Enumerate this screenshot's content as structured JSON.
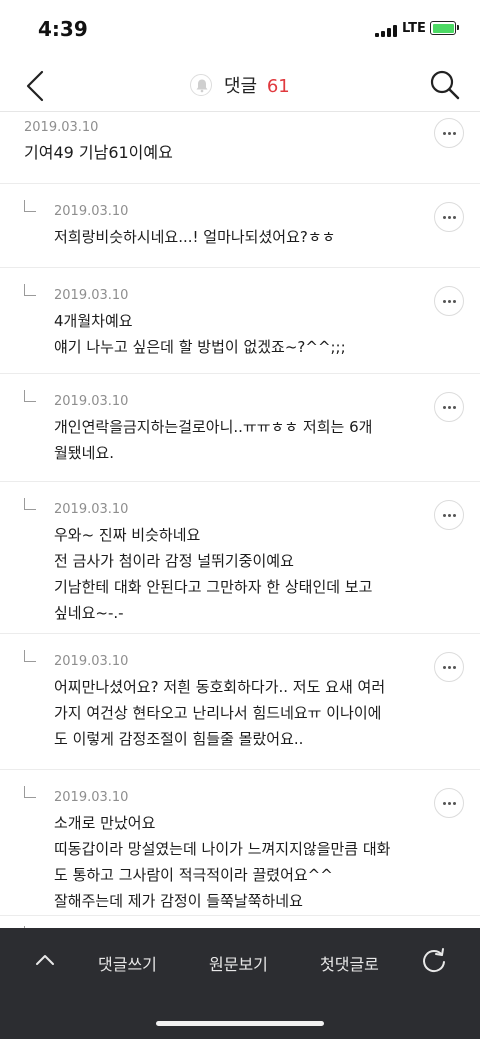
{
  "status": {
    "time": "4:39",
    "network": "LTE"
  },
  "nav": {
    "title": "댓글",
    "count": "61"
  },
  "comments": [
    {
      "date": "2019.03.10",
      "text": "기여49 기남61이예요",
      "reply": false
    },
    {
      "date": "2019.03.10",
      "text": "저희랑비슷하시네요...! 얼마나되셨어요?ㅎㅎ",
      "reply": true
    },
    {
      "date": "2019.03.10",
      "text": "4개월차예요\n얘기 나누고 싶은데 할 방법이 없겠죠~?^^;;;",
      "reply": true
    },
    {
      "date": "2019.03.10",
      "text": "개인연락을금지하는걸로아니..ㅠㅠㅎㅎ 저희는 6개\n월됐네요.",
      "reply": true
    },
    {
      "date": "2019.03.10",
      "text": "우와~ 진짜 비슷하네요\n전 금사가 첨이라 감정 널뛰기중이예요\n기남한테 대화 안된다고 그만하자 한 상태인데 보고\n싶네요~-.-",
      "reply": true
    },
    {
      "date": "2019.03.10",
      "text": "어찌만나셨어요? 저흰 동호회하다가.. 저도 요새 여러\n가지 여건상 현타오고 난리나서 힘드네요ㅠ 이나이에\n도 이렇게 감정조절이 힘들줄 몰랐어요..",
      "reply": true
    },
    {
      "date": "2019.03.10",
      "text": "소개로 만났어요\n띠동갑이라 망설였는데 나이가 느껴지지않을만큼 대화\n도 통하고 그사람이 적극적이라 끌렸어요^^\n잘해주는데 제가 감정이 들쭉날쭉하네요",
      "reply": true
    },
    {
      "date": "",
      "text": "",
      "reply": true
    }
  ],
  "bottom_bar": {
    "write": "댓글쓰기",
    "original": "원문보기",
    "first": "첫댓글로"
  },
  "icons": {
    "back": "chevron-left-icon",
    "bell": "bell-icon",
    "search": "search-icon",
    "more": "more-horizontal-icon",
    "up": "chevron-up-icon",
    "refresh": "refresh-icon"
  },
  "colors": {
    "accent": "#e0393e",
    "bottom_bar": "#2c2d31",
    "battery": "#4cd964"
  }
}
